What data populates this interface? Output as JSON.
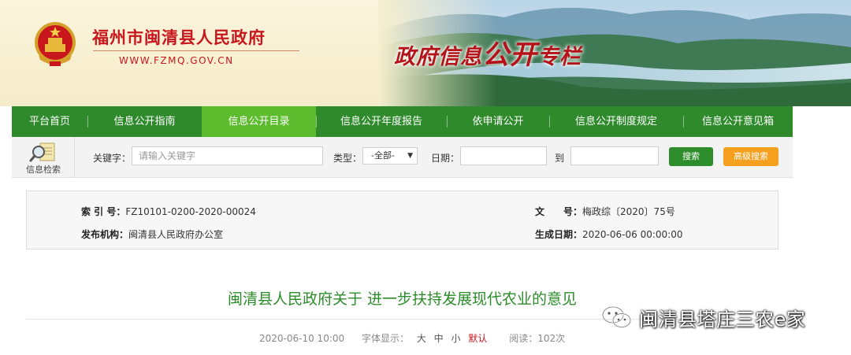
{
  "header": {
    "site_title": "福州市闽清县人民政府",
    "site_url": "WWW.FZMQ.GOV.CN",
    "zone_title_a": "政府信息",
    "zone_title_b": "公开",
    "zone_title_c": "专栏"
  },
  "nav": {
    "items": [
      {
        "label": "平台首页"
      },
      {
        "label": "信息公开指南"
      },
      {
        "label": "信息公开目录",
        "active": true
      },
      {
        "label": "信息公开年度报告"
      },
      {
        "label": "依申请公开"
      },
      {
        "label": "信息公开制度规定"
      },
      {
        "label": "信息公开意见箱"
      }
    ]
  },
  "search": {
    "icon_label": "信息检索",
    "keyword_label": "关键字：",
    "keyword_placeholder": "请输入关键字",
    "type_label": "类型：",
    "type_value": "-全部-",
    "date_label": "日期：",
    "to_label": "到",
    "search_button": "搜索",
    "advanced_button": "高级搜索"
  },
  "meta": {
    "index_label": "索 引 号：",
    "index_value": "FZ10101-0200-2020-00024",
    "doc_label": "文　　号：",
    "doc_value": "梅政综〔2020〕75号",
    "org_label": "发布机构：",
    "org_value": "闽清县人民政府办公室",
    "date_label": "生成日期：",
    "date_value": "2020-06-06 00:00:00"
  },
  "article": {
    "title": "闽清县人民政府关于 进一步扶持发展现代农业的意见",
    "published": "2020-06-10 10:00",
    "font_label": "字体显示：",
    "font_large": "大",
    "font_medium": "中",
    "font_small": "小",
    "font_default": "默认",
    "views": "阅读：102次"
  },
  "watermark": {
    "text": "闽清县塔庄三农e家"
  },
  "colors": {
    "nav_bg": "#2f8a2c",
    "nav_active": "#5cbc2e",
    "title_red": "#c8161d",
    "article_title_green": "#2c8c2a",
    "search_btn": "#2e8d2b",
    "advanced_btn": "#f5a01e"
  }
}
